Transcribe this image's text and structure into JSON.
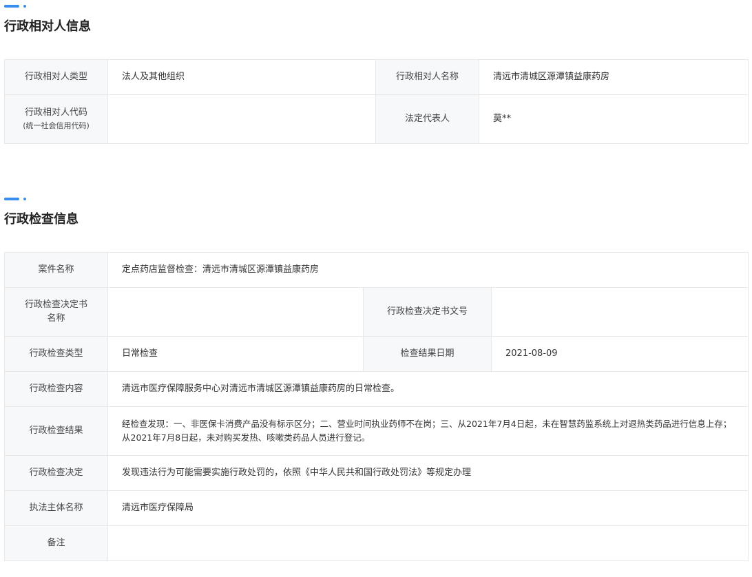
{
  "colors": {
    "accent": "#3b8cf0",
    "label_bg": "#f7f8fa",
    "border": "#e8e8e8"
  },
  "party": {
    "title": "行政相对人信息",
    "type_label": "行政相对人类型",
    "type_value": "法人及其他组织",
    "name_label": "行政相对人名称",
    "name_value": "清远市清城区源潭镇益康药房",
    "code_label": "行政相对人代码",
    "code_sublabel": "(统一社会信用代码)",
    "code_value": "",
    "rep_label": "法定代表人",
    "rep_value": "莫**"
  },
  "inspection": {
    "title": "行政检查信息",
    "case_label": "案件名称",
    "case_value": "定点药店监督检查：清远市清城区源潭镇益康药房",
    "doc_name_label": "行政检查决定书名称",
    "doc_name_value": "",
    "doc_no_label": "行政检查决定书文号",
    "doc_no_value": "",
    "type_label": "行政检查类型",
    "type_value": "日常检查",
    "date_label": "检查结果日期",
    "date_value": "2021-08-09",
    "content_label": "行政检查内容",
    "content_value": "清远市医疗保障服务中心对清远市清城区源潭镇益康药房的日常检查。",
    "result_label": "行政检查结果",
    "result_value": "经检查发现：一、非医保卡消费产品没有标示区分；二、营业时间执业药师不在岗；三、从2021年7月4日起，未在智慧药监系统上对退热类药品进行信息上存；从2021年7月8日起，未对购买发热、咳嗽类药品人员进行登记。",
    "decision_label": "行政检查决定",
    "decision_value": "发现违法行为可能需要实施行政处罚的，依照《中华人民共和国行政处罚法》等规定办理",
    "agency_label": "执法主体名称",
    "agency_value": "清远市医疗保障局",
    "remark_label": "备注",
    "remark_value": ""
  }
}
